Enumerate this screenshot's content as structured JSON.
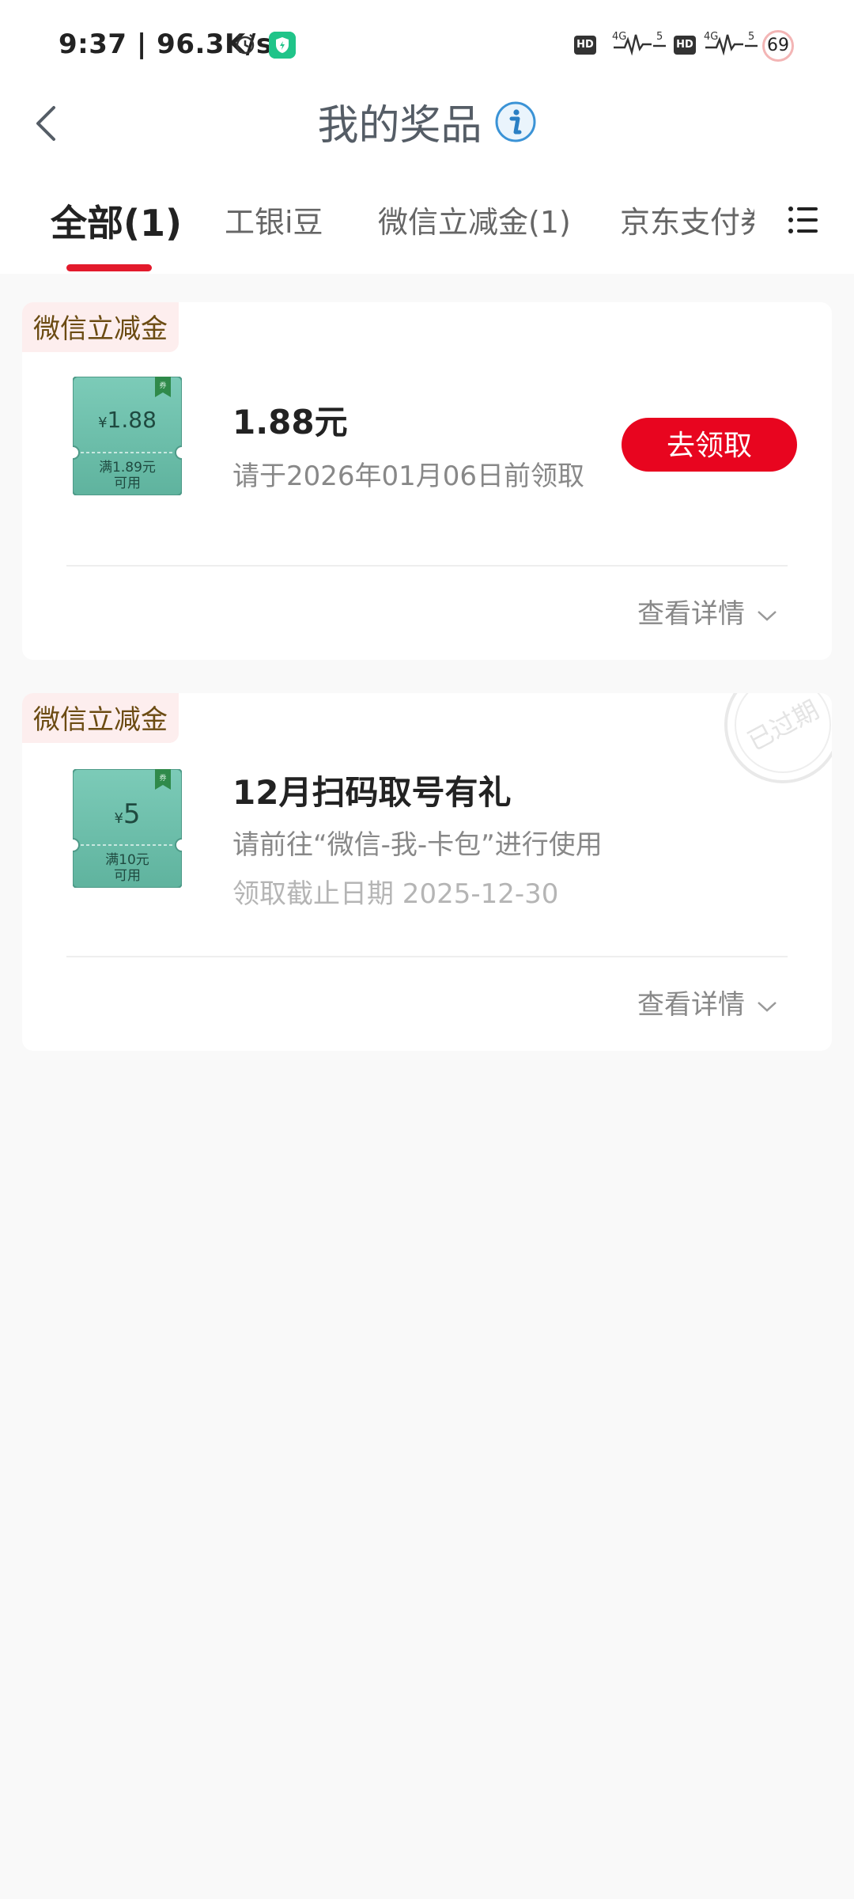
{
  "status_bar": {
    "time": "9:37 | 96.3K/s",
    "hd1": "HD",
    "hd2": "HD",
    "net1": "4G",
    "net2": "4G",
    "battery": "69"
  },
  "header": {
    "title": "我的奖品"
  },
  "tabs": [
    {
      "label": "全部(1)",
      "active": true
    },
    {
      "label": "工银i豆",
      "active": false
    },
    {
      "label": "微信立减金(1)",
      "active": false
    },
    {
      "label": "京东支付券",
      "active": false
    }
  ],
  "prizes": [
    {
      "badge": "微信立减金",
      "coupon_amount": "1.88",
      "coupon_symbol": "¥",
      "coupon_condition_line1": "满1.89元",
      "coupon_condition_line2": "可用",
      "title": "1.88元",
      "subtitle": "请于2026年01月06日前领取",
      "button": "去领取",
      "details": "查看详情"
    },
    {
      "badge": "微信立减金",
      "coupon_amount": "5",
      "coupon_symbol": "¥",
      "coupon_condition_line1": "满10元",
      "coupon_condition_line2": "可用",
      "title": "12月扫码取号有礼",
      "subtitle": "请前往“微信-我-卡包”进行使用",
      "deadline": "领取截止日期 2025-12-30",
      "stamp": "已过期",
      "details": "查看详情"
    }
  ],
  "colors": {
    "accent_red": "#e31a2c",
    "button_red": "#e8051f",
    "coupon_green": "#6ec2ae",
    "badge_bg": "#fdeeee",
    "badge_text": "#6b4b12"
  },
  "icons": {
    "back": "chevron-left-icon",
    "info": "info-icon",
    "menu": "list-menu-icon",
    "expand": "chevron-down-icon"
  }
}
